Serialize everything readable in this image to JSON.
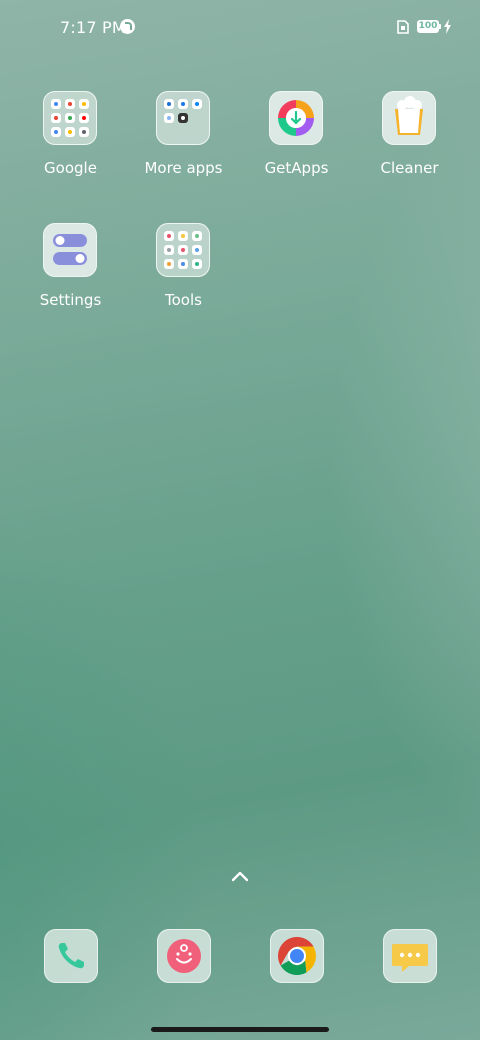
{
  "status_bar": {
    "time": "7:17 PM",
    "battery_level": "100",
    "icons": [
      "notification-app-icon",
      "sim-card-icon",
      "battery-icon",
      "charging-bolt-icon"
    ]
  },
  "apps": [
    {
      "label": "Google",
      "icon": "google-folder-icon"
    },
    {
      "label": "More apps",
      "icon": "more-apps-folder-icon"
    },
    {
      "label": "GetApps",
      "icon": "getapps-icon"
    },
    {
      "label": "Cleaner",
      "icon": "cleaner-icon"
    },
    {
      "label": "Settings",
      "icon": "settings-icon"
    },
    {
      "label": "Tools",
      "icon": "tools-folder-icon"
    }
  ],
  "dock": [
    {
      "name": "phone",
      "icon": "phone-icon"
    },
    {
      "name": "contacts",
      "icon": "contacts-icon"
    },
    {
      "name": "chrome",
      "icon": "chrome-icon"
    },
    {
      "name": "messages",
      "icon": "messages-icon"
    }
  ],
  "colors": {
    "wallpaper": "#6aa28f",
    "label_text": "#ffffff"
  }
}
